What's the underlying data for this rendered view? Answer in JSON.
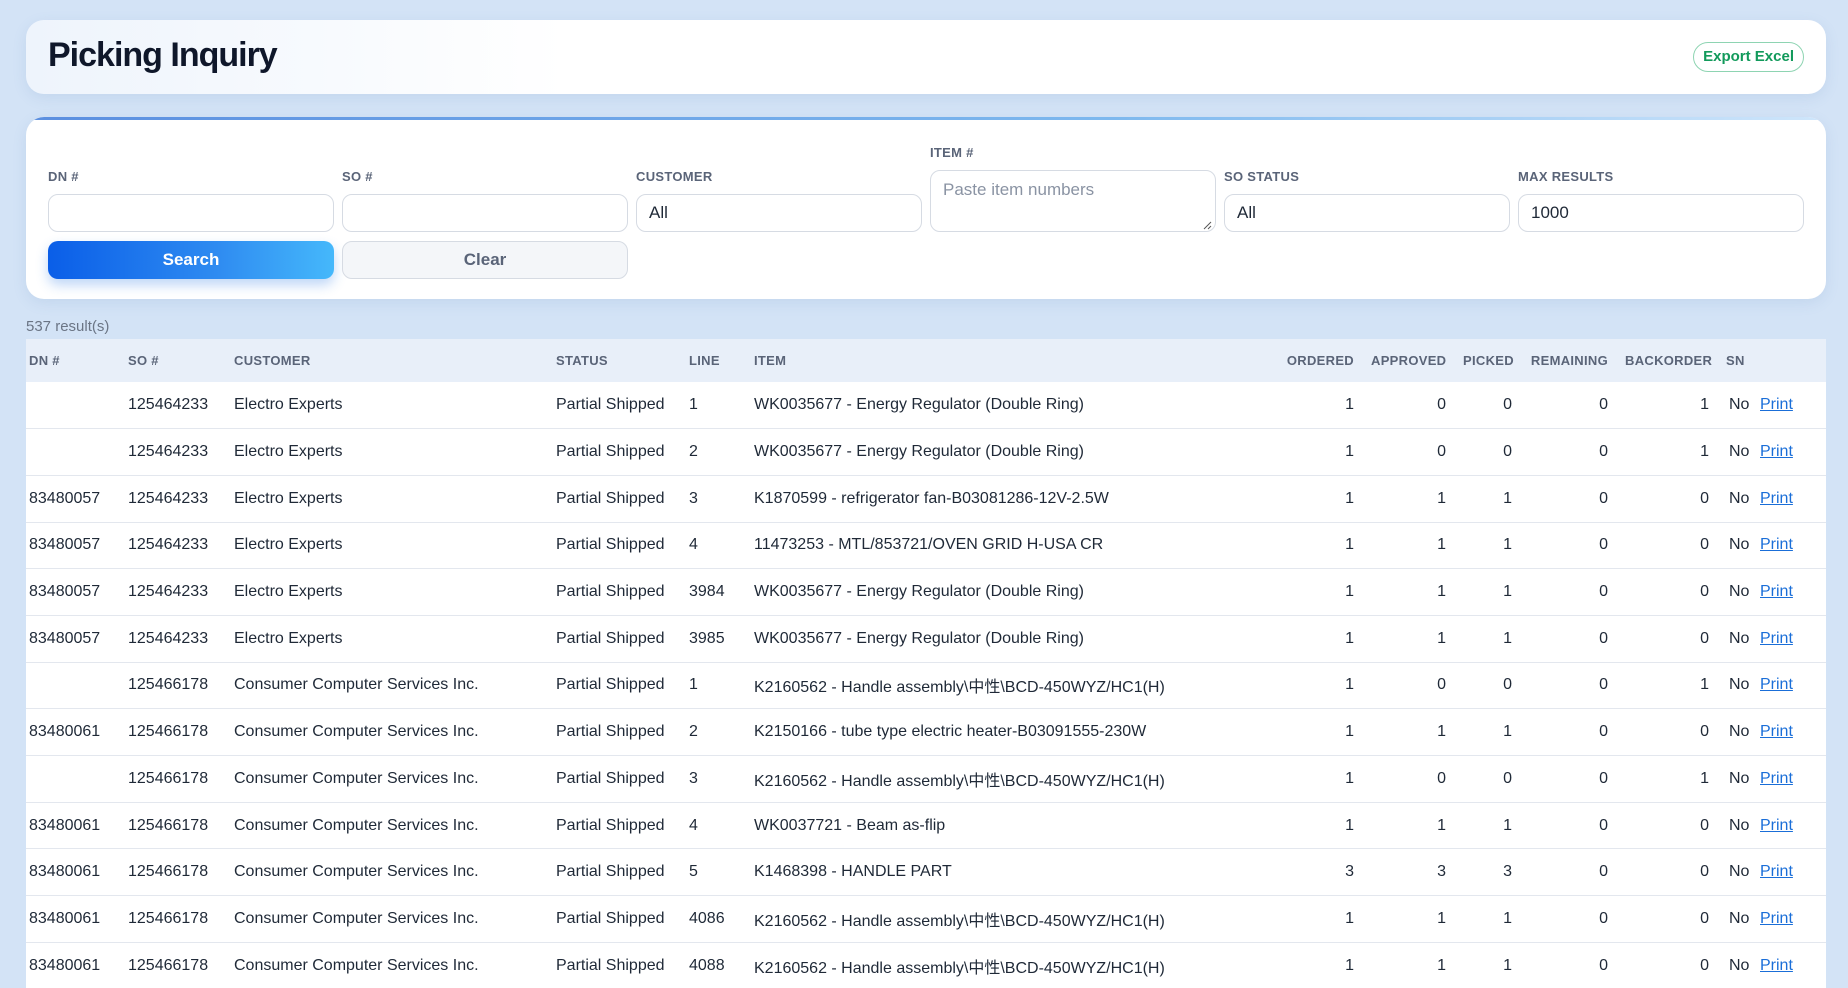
{
  "header": {
    "title": "Picking Inquiry",
    "export_label": "Export Excel"
  },
  "filters": {
    "dn_label": "DN #",
    "dn_value": "",
    "so_label": "SO #",
    "so_value": "",
    "customer_label": "CUSTOMER",
    "customer_value": "All",
    "item_label": "ITEM #",
    "item_placeholder": "Paste item numbers",
    "so_status_label": "SO STATUS",
    "so_status_value": "All",
    "max_results_label": "MAX RESULTS",
    "max_results_value": "1000",
    "search_label": "Search",
    "clear_label": "Clear"
  },
  "results": {
    "count_text": "537 result(s)",
    "columns": [
      "DN #",
      "SO #",
      "CUSTOMER",
      "STATUS",
      "LINE",
      "ITEM",
      "ORDERED",
      "APPROVED",
      "PICKED",
      "REMAINING",
      "BACKORDER",
      "SN",
      ""
    ],
    "rows": [
      {
        "dn": "",
        "so": "125464233",
        "customer": "Electro Experts",
        "status": "Partial Shipped",
        "line": "1",
        "item": "WK0035677 - Energy Regulator (Double Ring)",
        "ordered": "1",
        "approved": "0",
        "picked": "0",
        "remaining": "0",
        "backorder": "1",
        "sn": "No",
        "action": "Print"
      },
      {
        "dn": "",
        "so": "125464233",
        "customer": "Electro Experts",
        "status": "Partial Shipped",
        "line": "2",
        "item": "WK0035677 - Energy Regulator (Double Ring)",
        "ordered": "1",
        "approved": "0",
        "picked": "0",
        "remaining": "0",
        "backorder": "1",
        "sn": "No",
        "action": "Print"
      },
      {
        "dn": "83480057",
        "so": "125464233",
        "customer": "Electro Experts",
        "status": "Partial Shipped",
        "line": "3",
        "item": "K1870599 - refrigerator fan-B03081286-12V-2.5W",
        "ordered": "1",
        "approved": "1",
        "picked": "1",
        "remaining": "0",
        "backorder": "0",
        "sn": "No",
        "action": "Print"
      },
      {
        "dn": "83480057",
        "so": "125464233",
        "customer": "Electro Experts",
        "status": "Partial Shipped",
        "line": "4",
        "item": "11473253 - MTL/853721/OVEN GRID H-USA CR",
        "ordered": "1",
        "approved": "1",
        "picked": "1",
        "remaining": "0",
        "backorder": "0",
        "sn": "No",
        "action": "Print"
      },
      {
        "dn": "83480057",
        "so": "125464233",
        "customer": "Electro Experts",
        "status": "Partial Shipped",
        "line": "3984",
        "item": "WK0035677 - Energy Regulator (Double Ring)",
        "ordered": "1",
        "approved": "1",
        "picked": "1",
        "remaining": "0",
        "backorder": "0",
        "sn": "No",
        "action": "Print"
      },
      {
        "dn": "83480057",
        "so": "125464233",
        "customer": "Electro Experts",
        "status": "Partial Shipped",
        "line": "3985",
        "item": "WK0035677 - Energy Regulator (Double Ring)",
        "ordered": "1",
        "approved": "1",
        "picked": "1",
        "remaining": "0",
        "backorder": "0",
        "sn": "No",
        "action": "Print"
      },
      {
        "dn": "",
        "so": "125466178",
        "customer": "Consumer Computer Services Inc.",
        "status": "Partial Shipped",
        "line": "1",
        "item": "K2160562 - Handle assembly\\中性\\BCD-450WYZ/HC1(H)",
        "ordered": "1",
        "approved": "0",
        "picked": "0",
        "remaining": "0",
        "backorder": "1",
        "sn": "No",
        "action": "Print"
      },
      {
        "dn": "83480061",
        "so": "125466178",
        "customer": "Consumer Computer Services Inc.",
        "status": "Partial Shipped",
        "line": "2",
        "item": "K2150166 - tube type electric heater-B03091555-230W",
        "ordered": "1",
        "approved": "1",
        "picked": "1",
        "remaining": "0",
        "backorder": "0",
        "sn": "No",
        "action": "Print"
      },
      {
        "dn": "",
        "so": "125466178",
        "customer": "Consumer Computer Services Inc.",
        "status": "Partial Shipped",
        "line": "3",
        "item": "K2160562 - Handle assembly\\中性\\BCD-450WYZ/HC1(H)",
        "ordered": "1",
        "approved": "0",
        "picked": "0",
        "remaining": "0",
        "backorder": "1",
        "sn": "No",
        "action": "Print"
      },
      {
        "dn": "83480061",
        "so": "125466178",
        "customer": "Consumer Computer Services Inc.",
        "status": "Partial Shipped",
        "line": "4",
        "item": "WK0037721 - Beam as-flip",
        "ordered": "1",
        "approved": "1",
        "picked": "1",
        "remaining": "0",
        "backorder": "0",
        "sn": "No",
        "action": "Print"
      },
      {
        "dn": "83480061",
        "so": "125466178",
        "customer": "Consumer Computer Services Inc.",
        "status": "Partial Shipped",
        "line": "5",
        "item": "K1468398 - HANDLE PART",
        "ordered": "3",
        "approved": "3",
        "picked": "3",
        "remaining": "0",
        "backorder": "0",
        "sn": "No",
        "action": "Print"
      },
      {
        "dn": "83480061",
        "so": "125466178",
        "customer": "Consumer Computer Services Inc.",
        "status": "Partial Shipped",
        "line": "4086",
        "item": "K2160562 - Handle assembly\\中性\\BCD-450WYZ/HC1(H)",
        "ordered": "1",
        "approved": "1",
        "picked": "1",
        "remaining": "0",
        "backorder": "0",
        "sn": "No",
        "action": "Print"
      },
      {
        "dn": "83480061",
        "so": "125466178",
        "customer": "Consumer Computer Services Inc.",
        "status": "Partial Shipped",
        "line": "4088",
        "item": "K2160562 - Handle assembly\\中性\\BCD-450WYZ/HC1(H)",
        "ordered": "1",
        "approved": "1",
        "picked": "1",
        "remaining": "0",
        "backorder": "0",
        "sn": "No",
        "action": "Print"
      }
    ]
  },
  "colors": {
    "page_bg": "#d3e3f6",
    "accent_blue": "#1a6ed8",
    "export_green": "#129a5b"
  },
  "icons": {
    "textarea_resize": "resize-handle-icon"
  }
}
